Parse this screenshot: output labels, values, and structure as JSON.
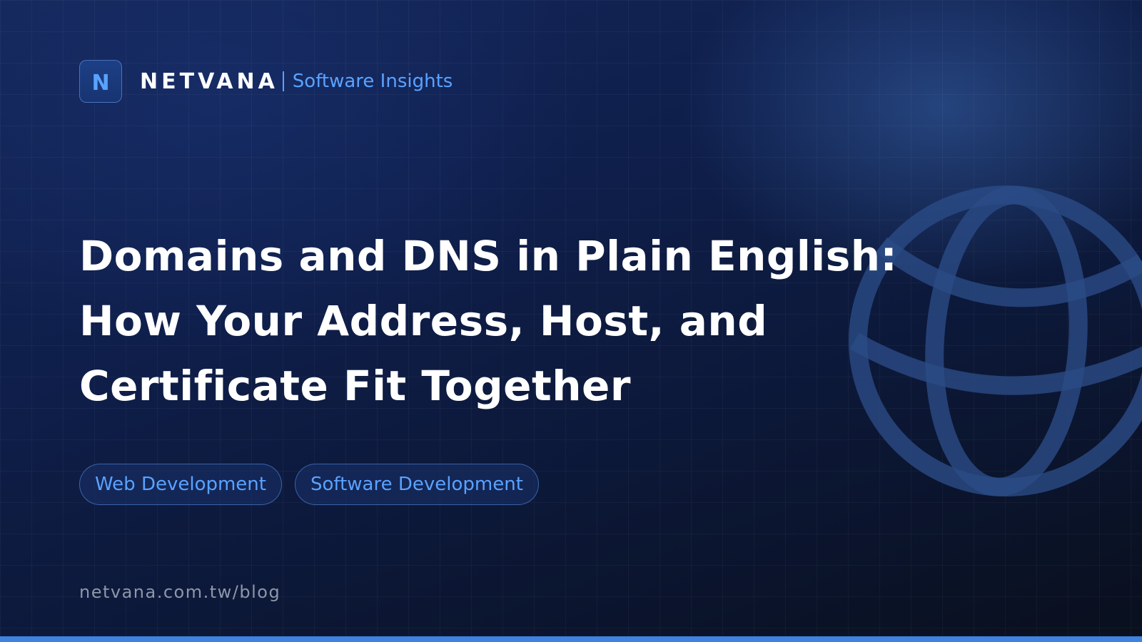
{
  "brand": {
    "logo_letter": "N",
    "name": "NETVANA",
    "tagline": "Software Insights"
  },
  "title": {
    "line1": "Domains and DNS in Plain English:",
    "line2": "How Your Address, Host, and",
    "line3": "Certificate Fit Together"
  },
  "tags": [
    {
      "label": "Web Development"
    },
    {
      "label": "Software Development"
    }
  ],
  "footer": {
    "url": "netvana.com.tw/blog"
  },
  "icons": {
    "background": "globe-icon"
  },
  "colors": {
    "accent": "#5aa2ff",
    "bottom_bar": "#3f82e0",
    "background_dark": "#0b1226",
    "url_text": "#8e96a8"
  }
}
